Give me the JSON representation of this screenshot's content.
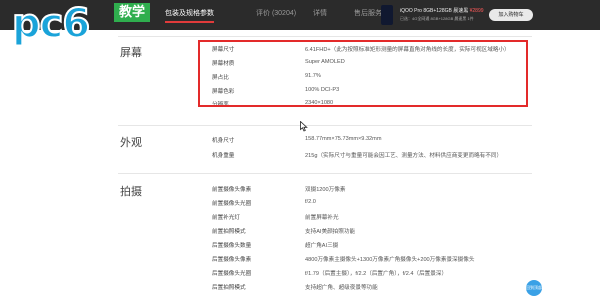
{
  "logo": {
    "text": "pc6",
    "badge": "教学"
  },
  "tabs": [
    {
      "label": "包装及规格参数",
      "active": true
    },
    {
      "label": "评价 (30204)",
      "active": false
    },
    {
      "label": "详情",
      "active": false
    },
    {
      "label": "售后服务",
      "active": false
    }
  ],
  "product": {
    "name": "iQOO Pro 8GB+128GB 晨速黑",
    "price": "¥2899",
    "sub": "已选：4G全网通 8GB+128GB 晨速黑 1件",
    "cart_label": "加入购物车"
  },
  "sections": [
    {
      "title": "屏幕",
      "rows": [
        {
          "label": "屏幕尺寸",
          "value": "6.41FHD+（此为按照标准矩形测量的屏幕直角对角线的长度，实际可视区域略小）"
        },
        {
          "label": "屏幕材质",
          "value": "Super AMOLED"
        },
        {
          "label": "屏占比",
          "value": "91.7%"
        },
        {
          "label": "屏幕色彩",
          "value": "100% DCI-P3"
        },
        {
          "label": "分辨率",
          "value": "2340×1080"
        }
      ]
    },
    {
      "title": "外观",
      "rows": [
        {
          "label": "机身尺寸",
          "value": "158.77mm×75.73mm×9.32mm"
        },
        {
          "label": "机身重量",
          "value": "215g（实际尺寸与重量可能会因工艺、测量方法、材料供应商变更而略有不同）"
        }
      ]
    },
    {
      "title": "拍摄",
      "rows": [
        {
          "label": "前置摄像头像素",
          "value": "双摄1200万像素"
        },
        {
          "label": "前置摄像头光圈",
          "value": "f/2.0"
        },
        {
          "label": "前置补光灯",
          "value": "前置屏幕补光"
        },
        {
          "label": "前置拍照模式",
          "value": "支持AI美颜拍照功能"
        },
        {
          "label": "后置摄像头数量",
          "value": "超广角AI三摄"
        },
        {
          "label": "后置摄像头像素",
          "value": "4800万像素主摄像头+1300万像素广角摄像头+200万像素景深摄像头"
        },
        {
          "label": "后置摄像头光圈",
          "value": "f/1.79（后置主摄），f/2.2（后置广角），f/2.4（后置景深）"
        },
        {
          "label": "后置拍照模式",
          "value": "支持超广角、超级夜景等功能"
        }
      ]
    }
  ],
  "float_button": "回到顶部"
}
